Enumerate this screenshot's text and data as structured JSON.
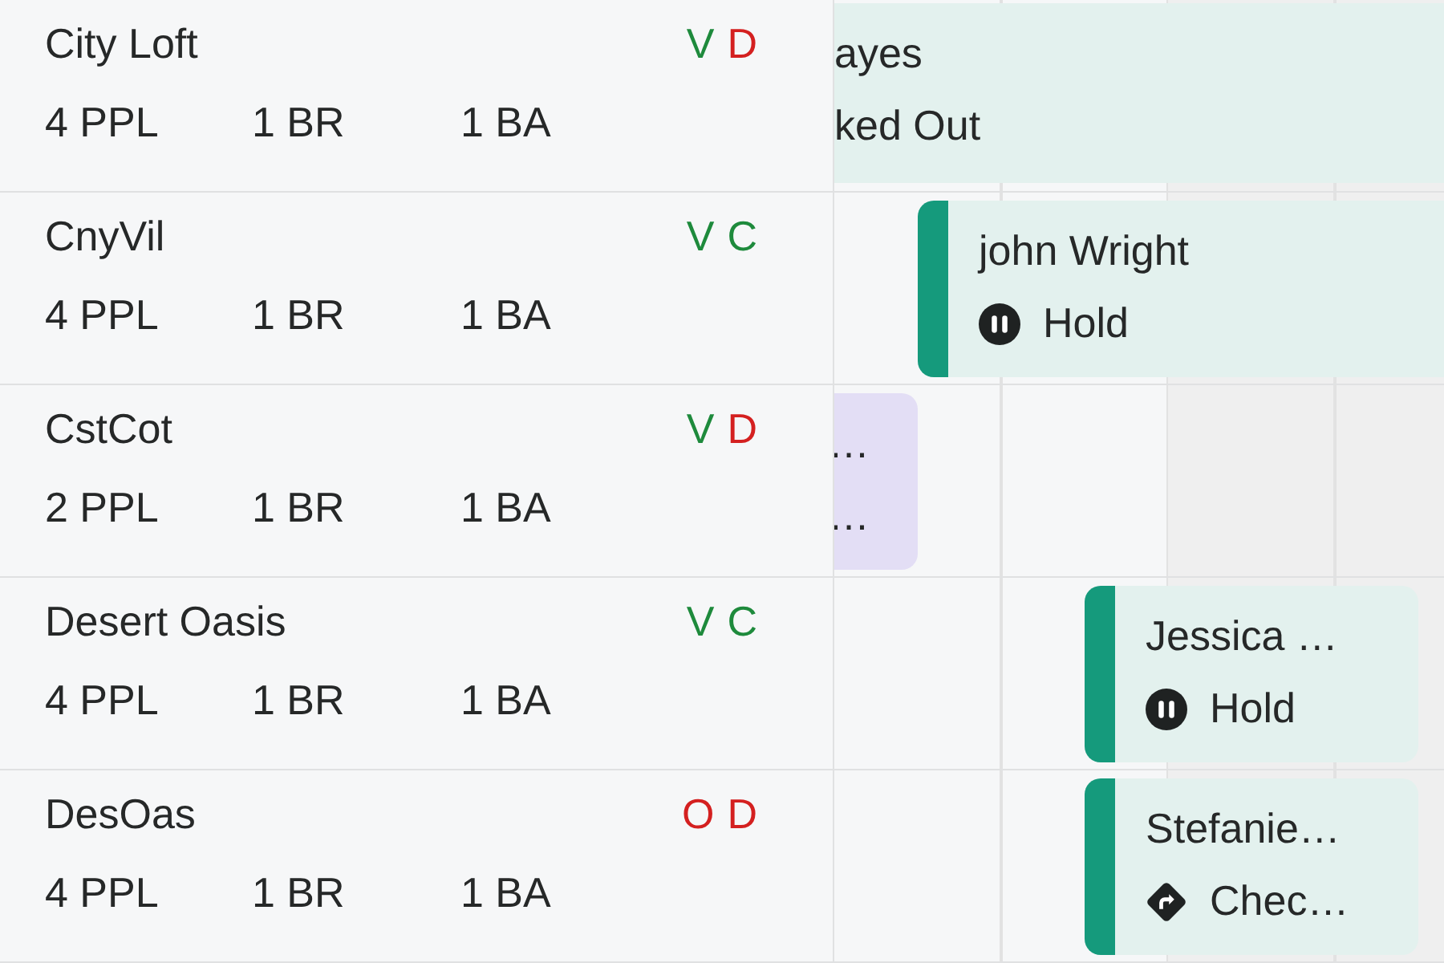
{
  "listings": [
    {
      "name": "City Loft",
      "specs": [
        "4 PPL",
        "1 BR",
        "1 BA"
      ],
      "codes": [
        {
          "text": "V",
          "color": "#1e8a3c"
        },
        {
          "text": "D",
          "color": "#d42020"
        }
      ],
      "booking": {
        "guest": "ayes",
        "status": "ked Out",
        "kind": "plain",
        "color": "#e3f1ee"
      }
    },
    {
      "name": "CnyVil",
      "specs": [
        "4 PPL",
        "1 BR",
        "1 BA"
      ],
      "codes": [
        {
          "text": "V",
          "color": "#1e8a3c"
        },
        {
          "text": "C",
          "color": "#1e8a3c"
        }
      ],
      "booking": {
        "guest": "john Wright",
        "status": "Hold",
        "kind": "hold",
        "color": "#e3f1ee",
        "accent": true
      }
    },
    {
      "name": "CstCot",
      "specs": [
        "2 PPL",
        "1 BR",
        "1 BA"
      ],
      "codes": [
        {
          "text": "V",
          "color": "#1e8a3c"
        },
        {
          "text": "D",
          "color": "#d42020"
        }
      ],
      "booking": {
        "guest": "…",
        "status": "…",
        "kind": "plain",
        "color": "#e3def5"
      }
    },
    {
      "name": "Desert Oasis",
      "specs": [
        "4 PPL",
        "1 BR",
        "1 BA"
      ],
      "codes": [
        {
          "text": "V",
          "color": "#1e8a3c"
        },
        {
          "text": "C",
          "color": "#1e8a3c"
        }
      ],
      "booking": {
        "guest": "Jessica …",
        "status": "Hold",
        "kind": "hold",
        "color": "#e3f1ee",
        "accent": true
      }
    },
    {
      "name": "DesOas",
      "specs": [
        "4 PPL",
        "1 BR",
        "1 BA"
      ],
      "codes": [
        {
          "text": "O",
          "color": "#d42020"
        },
        {
          "text": "D",
          "color": "#d42020"
        }
      ],
      "booking": {
        "guest": "Stefanie…",
        "status": "Chec…",
        "kind": "checkin",
        "color": "#e3f1ee",
        "accent": true
      }
    }
  ]
}
